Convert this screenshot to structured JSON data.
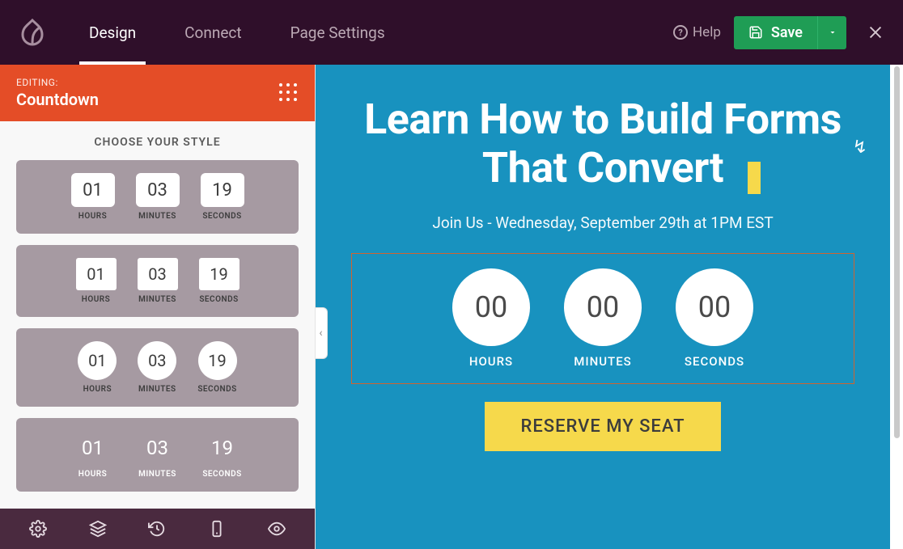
{
  "topbar": {
    "tabs": [
      "Design",
      "Connect",
      "Page Settings"
    ],
    "help_label": "Help",
    "save_label": "Save"
  },
  "sidebar": {
    "editing_label": "EDITING:",
    "editing_name": "Countdown",
    "style_title": "CHOOSE YOUR STYLE",
    "styles": [
      {
        "hours": "01",
        "minutes": "03",
        "seconds": "19",
        "h_label": "HOURS",
        "m_label": "MINUTES",
        "s_label": "SECONDS",
        "variant": "box"
      },
      {
        "hours": "01",
        "minutes": "03",
        "seconds": "19",
        "h_label": "HOURS",
        "m_label": "MINUTES",
        "s_label": "SECONDS",
        "variant": "card"
      },
      {
        "hours": "01",
        "minutes": "03",
        "seconds": "19",
        "h_label": "HOURS",
        "m_label": "MINUTES",
        "s_label": "SECONDS",
        "variant": "circle"
      },
      {
        "hours": "01",
        "minutes": "03",
        "seconds": "19",
        "h_label": "HOURS",
        "m_label": "MINUTES",
        "s_label": "SECONDS",
        "variant": "plain"
      }
    ]
  },
  "canvas": {
    "headline": "Learn How to Build Forms That Convert",
    "subhead": "Join Us - Wednesday, September 29th at 1PM EST",
    "countdown": {
      "hours": "00",
      "minutes": "00",
      "seconds": "00",
      "h_label": "HOURS",
      "m_label": "MINUTES",
      "s_label": "SECONDS"
    },
    "cta_label": "RESERVE MY SEAT"
  }
}
